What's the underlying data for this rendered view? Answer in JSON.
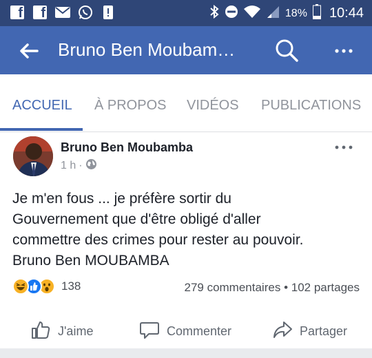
{
  "status_bar": {
    "notification_icons": [
      "facebook-icon",
      "facebook-icon",
      "mail-icon",
      "whatsapp-icon",
      "alert-icon"
    ],
    "battery": "18%",
    "time": "10:44"
  },
  "toolbar": {
    "title": "Bruno Ben Moubam…",
    "accent": "#4267b2"
  },
  "tabs": [
    {
      "label": "ACCUEIL",
      "active": true
    },
    {
      "label": "À PROPOS",
      "active": false
    },
    {
      "label": "VIDÉOS",
      "active": false
    },
    {
      "label": "PUBLICATIONS",
      "active": false
    }
  ],
  "post": {
    "author": "Bruno Ben Moubamba",
    "time": "1 h",
    "text_lines": [
      "Je m'en fous ... je préfère sortir du",
      "Gouvernement que d'être obligé d'aller",
      "commettre des crimes pour rester au pouvoir.",
      "Bruno Ben MOUBAMBA"
    ],
    "reactions": [
      "haha",
      "like",
      "wow"
    ],
    "reaction_count": "138",
    "comments": "279 commentaires",
    "separator": "•",
    "shares": "102 partages"
  },
  "actions": {
    "like": "J'aime",
    "comment": "Commenter",
    "share": "Partager"
  }
}
